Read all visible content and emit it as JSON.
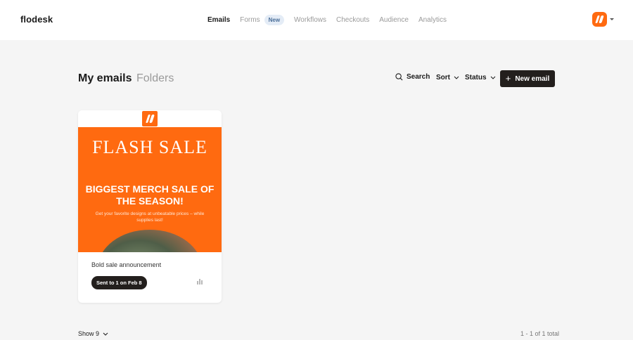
{
  "app": {
    "logo": "flodesk"
  },
  "nav": {
    "emails": "Emails",
    "forms": "Forms",
    "forms_badge": "New",
    "workflows": "Workflows",
    "checkouts": "Checkouts",
    "audience": "Audience",
    "analytics": "Analytics"
  },
  "header": {
    "title": "My emails",
    "folders": "Folders",
    "search": "Search",
    "sort": "Sort",
    "status": "Status",
    "new_email": "New email"
  },
  "cards": [
    {
      "preview": {
        "headline": "FLASH SALE",
        "subheadline": "BIGGEST MERCH SALE OF THE SEASON!",
        "body": "Get your favorite designs at unbeatable prices – while supplies last!"
      },
      "title": "Bold sale announcement",
      "status": "Sent to 1 on Feb 8"
    }
  ],
  "footer": {
    "show": "Show 9",
    "total": "1 - 1 of 1 total"
  },
  "colors": {
    "brand_orange": "#ff6a10",
    "dark_button": "#231f1d"
  },
  "icons": [
    "search-icon",
    "chevron-down-icon",
    "plus-icon",
    "bar-chart-icon",
    "flodesk-mark-icon"
  ]
}
